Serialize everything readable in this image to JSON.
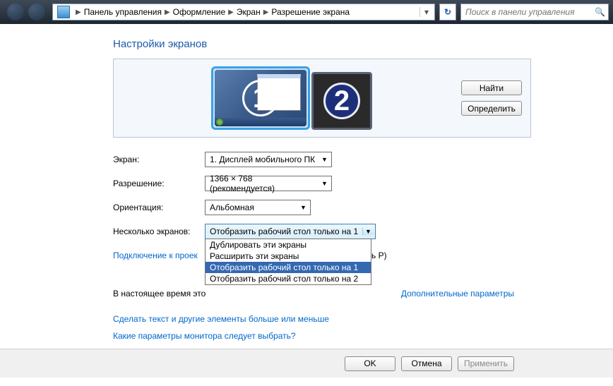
{
  "breadcrumb": {
    "p1": "Панель управления",
    "p2": "Оформление",
    "p3": "Экран",
    "p4": "Разрешение экрана"
  },
  "search": {
    "placeholder": "Поиск в панели управления"
  },
  "title": "Настройки экранов",
  "preview": {
    "find": "Найти",
    "identify": "Определить",
    "mon1_num": "1",
    "mon2_num": "2"
  },
  "labels": {
    "display": "Экран:",
    "resolution": "Разрешение:",
    "orientation": "Ориентация:",
    "multiple": "Несколько экранов:"
  },
  "values": {
    "display": "1. Дисплей мобильного ПК",
    "resolution": "1366 × 768 (рекомендуется)",
    "orientation": "Альбомная",
    "multiple": "Отобразить рабочий стол только на 1"
  },
  "dropdown": {
    "opt1": "Дублировать эти экраны",
    "opt2": "Расширить эти экраны",
    "opt3": "Отобразить рабочий стол только на 1",
    "opt4": "Отобразить рабочий стол только на 2"
  },
  "note_part1": "В настоящее время это",
  "note_part2": "сь P)",
  "advanced": "Дополнительные параметры",
  "links": {
    "projector": "Подключение к проек",
    "text_size": "Сделать текст и другие элементы больше или меньше",
    "which": "Какие параметры монитора следует выбрать?"
  },
  "footer": {
    "ok": "OK",
    "cancel": "Отмена",
    "apply": "Применить"
  }
}
